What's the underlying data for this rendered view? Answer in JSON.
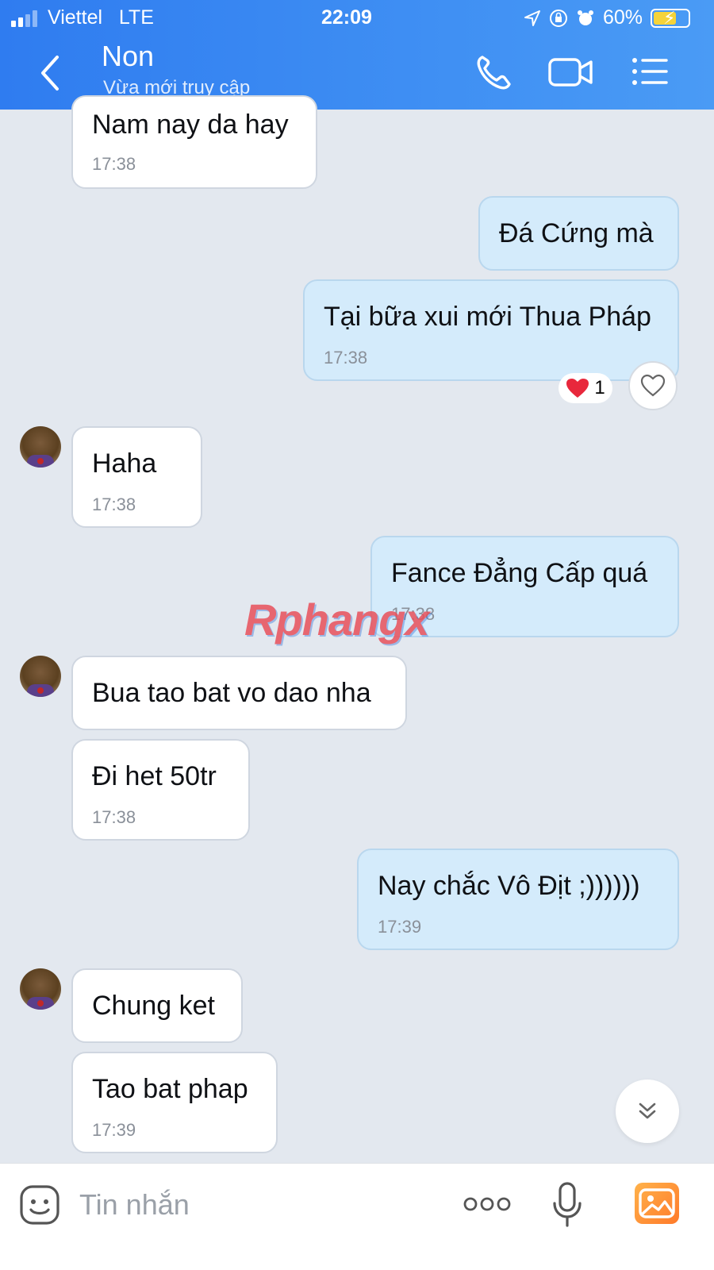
{
  "status_bar": {
    "carrier": "Viettel",
    "network": "LTE",
    "time": "22:09",
    "battery": "60%"
  },
  "header": {
    "contact_name": "Non",
    "contact_status": "Vừa mới truy cập"
  },
  "messages": [
    {
      "side": "in",
      "text": "Nam nay da hay",
      "time": "17:38"
    },
    {
      "side": "out",
      "text": "Đá Cứng mà"
    },
    {
      "side": "out",
      "text": "Tại bữa xui mới Thua Pháp",
      "time": "17:38",
      "reaction_count": "1"
    },
    {
      "side": "in",
      "text": "Haha",
      "time": "17:38"
    },
    {
      "side": "out",
      "text": "Fance Đẳng Cấp quá",
      "time": "17:38"
    },
    {
      "side": "in",
      "text": "Bua tao bat vo dao nha"
    },
    {
      "side": "in",
      "text": "Đi het 50tr",
      "time": "17:38"
    },
    {
      "side": "out",
      "text": "Nay chắc Vô Địt ;))))))",
      "time": "17:39"
    },
    {
      "side": "in",
      "text": "Chung ket"
    },
    {
      "side": "in",
      "text": "Tao bat phap",
      "time": "17:39"
    }
  ],
  "watermark": "Rphangx",
  "composer": {
    "placeholder": "Tin nhắn"
  },
  "colors": {
    "header": "#3a8af2",
    "chat_background": "#e3e8ef",
    "incoming_bubble": "#ffffff",
    "outgoing_bubble": "#d4ebfb"
  }
}
